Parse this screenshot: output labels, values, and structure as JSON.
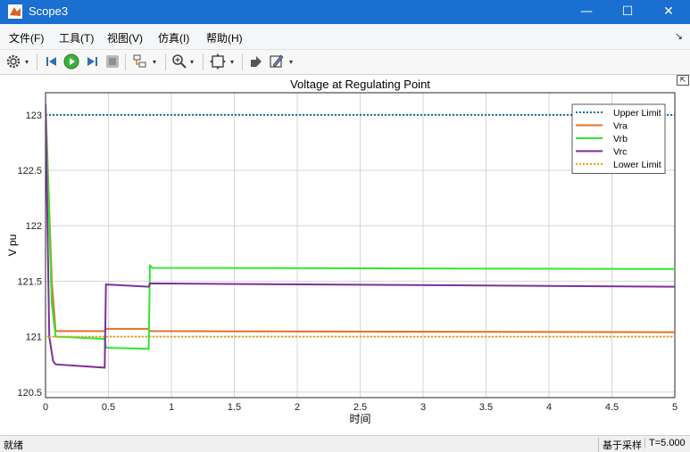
{
  "window": {
    "title": "Scope3",
    "min_glyph": "—",
    "max_glyph": "☐",
    "close_glyph": "✕"
  },
  "menu": {
    "items": [
      "文件(F)",
      "工具(T)",
      "视图(V)",
      "仿真(I)",
      "帮助(H)"
    ],
    "expand_glyph": "↘"
  },
  "toolbar": {
    "icons": [
      "gear-icon",
      "step-back-icon",
      "run-icon",
      "step-forward-icon",
      "stop-icon",
      "highlight-block-icon",
      "zoom-icon",
      "autoscale-icon",
      "restore-view-icon",
      "trigger-icon"
    ],
    "drop_glyph": "▾"
  },
  "statusbar": {
    "ready": "就绪",
    "sample": "基于采样",
    "time": "T=5.000"
  },
  "colors": {
    "upper": "#1a6f9a",
    "vra": "#e0702a",
    "vrb": "#2ee82e",
    "vrc": "#7e2f9a",
    "lower": "#e8a21a",
    "titlebar": "#1b6fd0"
  },
  "chart_data": {
    "type": "line",
    "title": "Voltage at Regulating Point",
    "xlabel": "时间",
    "ylabel": "V pu",
    "xlim": [
      0,
      5
    ],
    "ylim": [
      120.45,
      123.2
    ],
    "x_ticks": [
      "0",
      "0.5",
      "1",
      "1.5",
      "2",
      "2.5",
      "3",
      "3.5",
      "4",
      "4.5",
      "5"
    ],
    "y_ticks": [
      "120.5",
      "121",
      "121.5",
      "122",
      "122.5",
      "123"
    ],
    "grid": true,
    "legend_position": "top-right",
    "series": [
      {
        "name": "Upper Limit",
        "x": [
          0,
          5
        ],
        "y": [
          123.0,
          123.0
        ]
      },
      {
        "name": "Vra",
        "x": [
          0,
          0.05,
          0.08,
          0.47,
          0.48,
          0.82,
          0.83,
          5
        ],
        "y": [
          123.1,
          121.5,
          121.05,
          121.05,
          121.07,
          121.07,
          121.05,
          121.04
        ]
      },
      {
        "name": "Vrb",
        "x": [
          0,
          0.05,
          0.08,
          0.47,
          0.48,
          0.82,
          0.83,
          0.85,
          5
        ],
        "y": [
          123.1,
          121.3,
          121.0,
          120.98,
          120.9,
          120.89,
          121.64,
          121.62,
          121.61
        ]
      },
      {
        "name": "Vrc",
        "x": [
          0,
          0.03,
          0.06,
          0.08,
          0.47,
          0.48,
          0.82,
          0.83,
          5
        ],
        "y": [
          123.1,
          121.0,
          120.78,
          120.75,
          120.72,
          121.47,
          121.45,
          121.48,
          121.45
        ]
      },
      {
        "name": "Lower Limit",
        "x": [
          0,
          5
        ],
        "y": [
          121.0,
          121.0
        ]
      }
    ]
  }
}
